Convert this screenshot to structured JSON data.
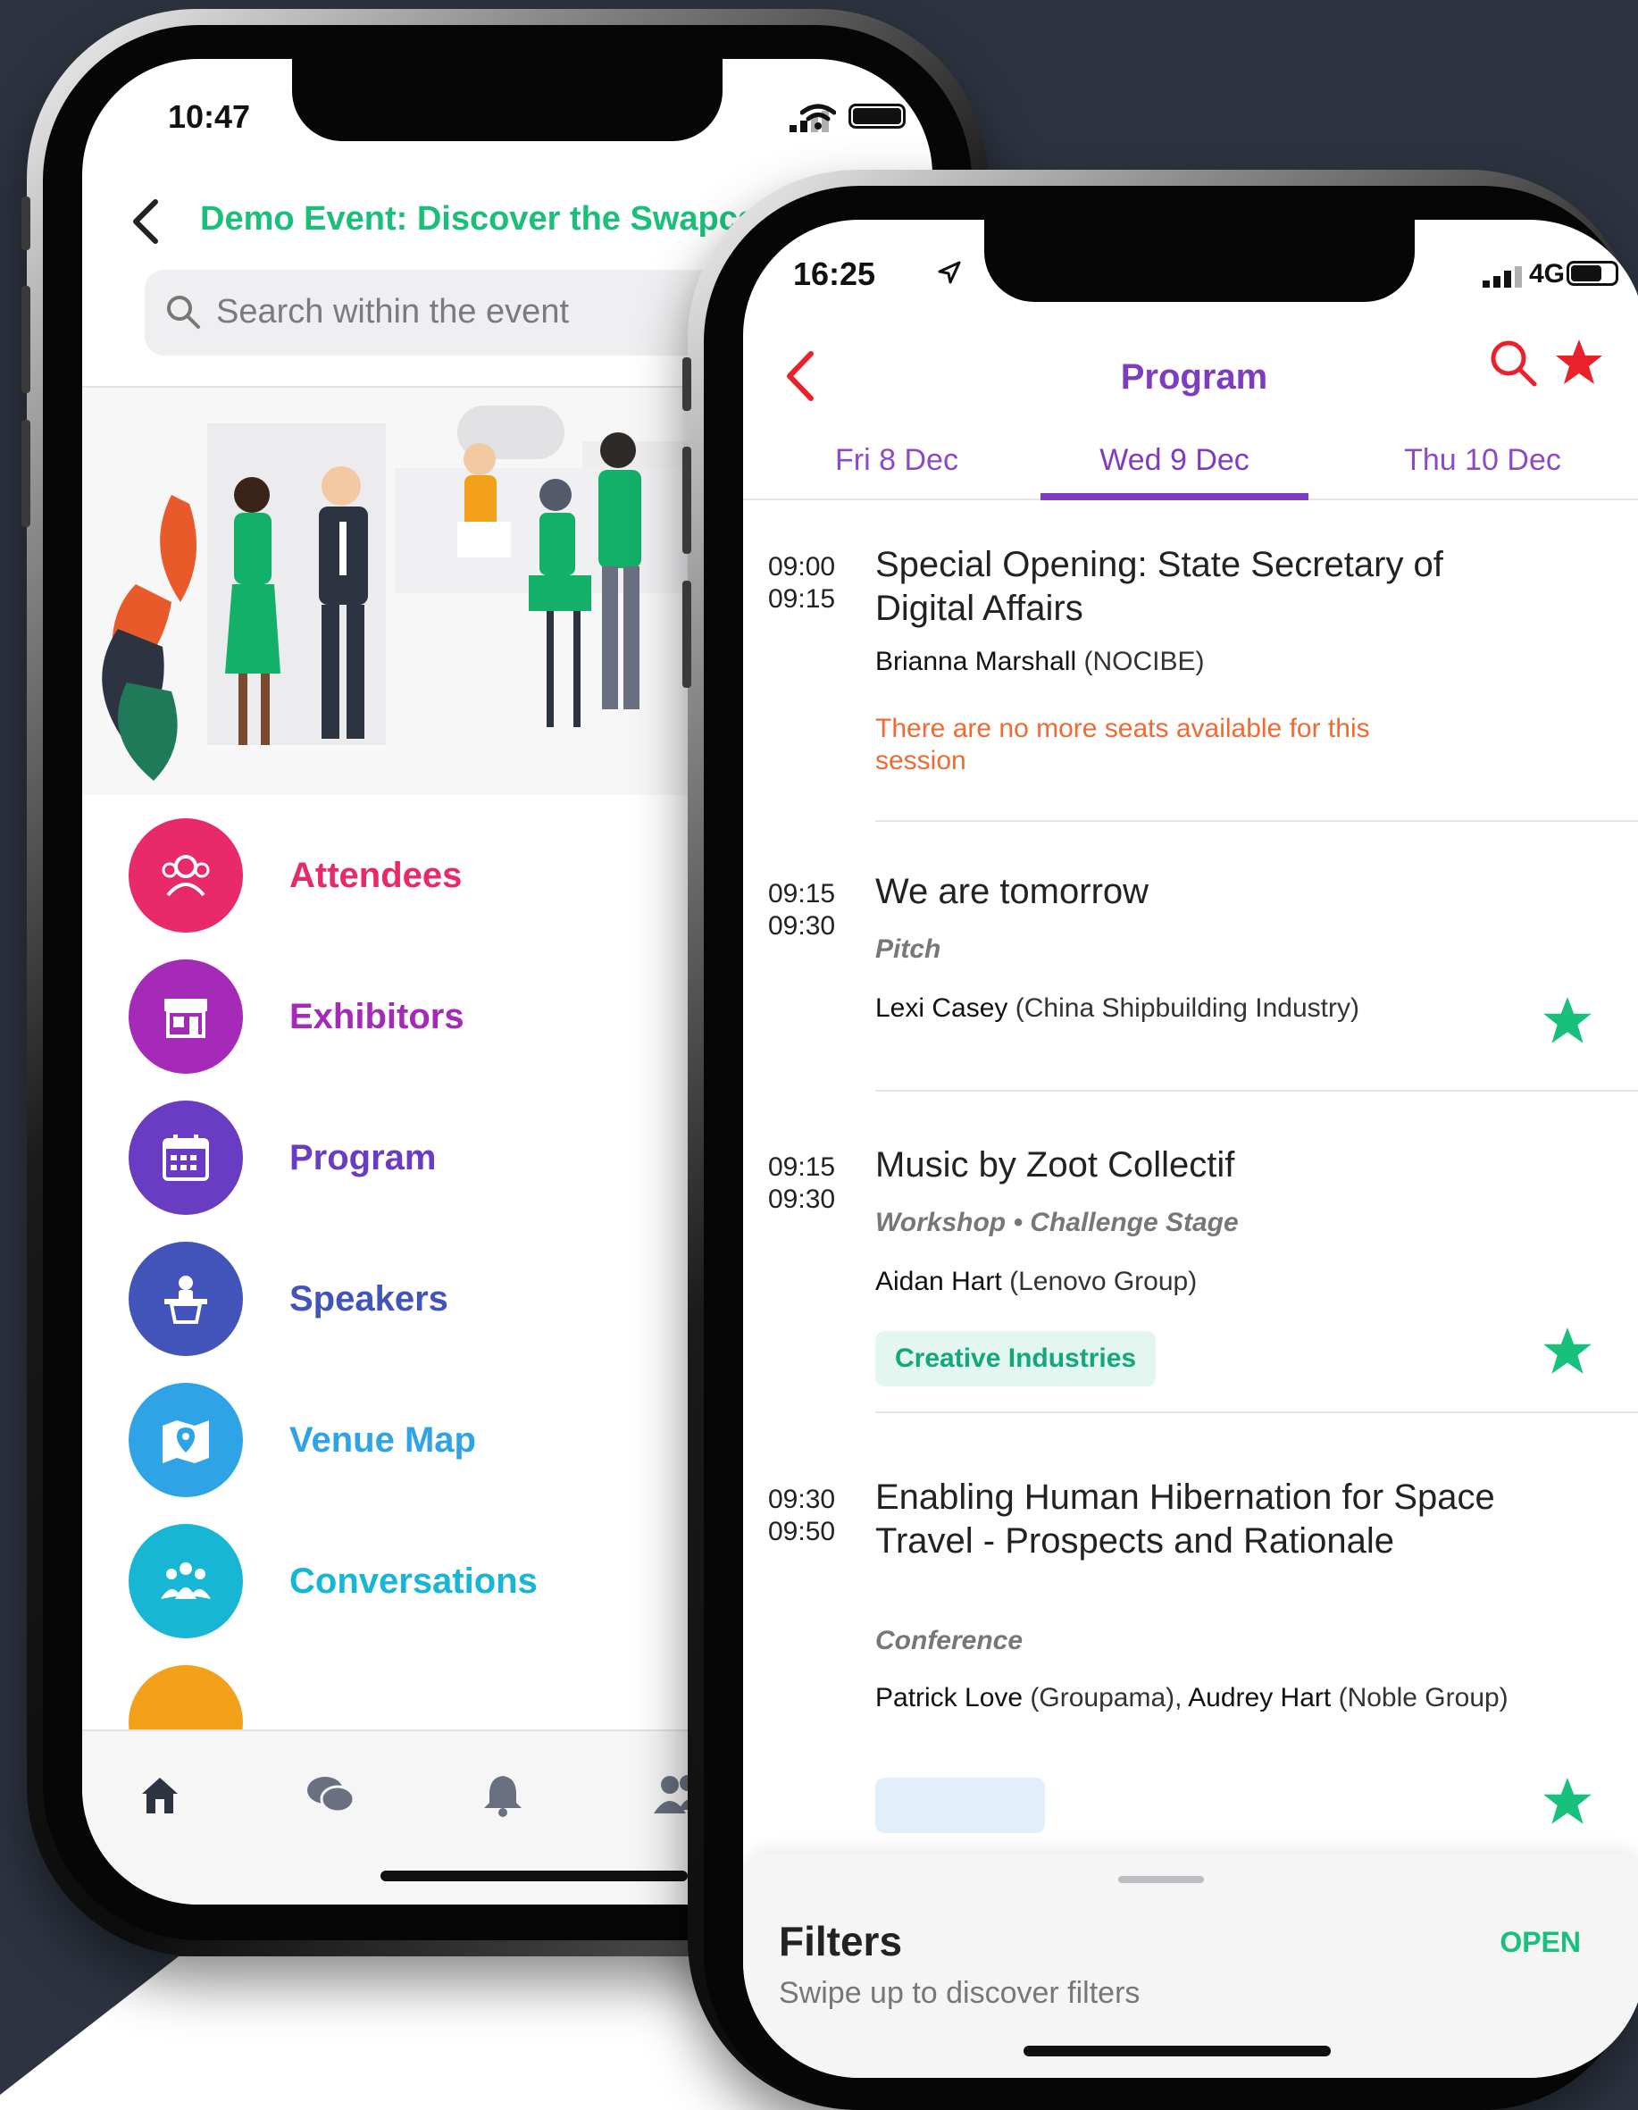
{
  "left_phone": {
    "status": {
      "time": "10:47"
    },
    "header": {
      "title": "Demo Event: Discover the Swapca"
    },
    "search": {
      "placeholder": "Search within the event"
    },
    "menu": [
      {
        "label": "Attendees",
        "icon": "attendees-icon",
        "color": "#e8296a"
      },
      {
        "label": "Exhibitors",
        "icon": "store-icon",
        "color": "#a52ab8"
      },
      {
        "label": "Program",
        "icon": "calendar-icon",
        "color": "#6a3bc3"
      },
      {
        "label": "Speakers",
        "icon": "podium-icon",
        "color": "#4254ba"
      },
      {
        "label": "Venue Map",
        "icon": "map-pin-icon",
        "color": "#2ea4e6"
      },
      {
        "label": "Conversations",
        "icon": "group-icon",
        "color": "#17b6d4"
      }
    ],
    "tabbar": [
      "home-icon",
      "chat-icon",
      "bell-icon",
      "people-icon"
    ]
  },
  "right_phone": {
    "status": {
      "time": "16:25",
      "network": "4G"
    },
    "header": {
      "title": "Program"
    },
    "tabs": [
      "Fri 8 Dec",
      "Wed 9 Dec",
      "Thu 10 Dec"
    ],
    "active_tab": "Wed 9 Dec",
    "sessions": [
      {
        "start": "09:00",
        "end": "09:15",
        "title": "Special Opening: State Secretary of Digital Affairs",
        "speakers": [
          {
            "name": "Brianna Marshall",
            "org": "(NOCIBE)"
          }
        ],
        "warning": "There are no more seats available for this session"
      },
      {
        "start": "09:15",
        "end": "09:30",
        "title": "We are tomorrow",
        "type": "Pitch",
        "speakers": [
          {
            "name": "Lexi Casey",
            "org": "(China Shipbuilding Industry)"
          }
        ],
        "starred": true
      },
      {
        "start": "09:15",
        "end": "09:30",
        "title": "Music by Zoot Collectif",
        "type": "Workshop • Challenge Stage",
        "speakers": [
          {
            "name": "Aidan Hart",
            "org": "(Lenovo Group)"
          }
        ],
        "tag": "Creative Industries",
        "starred": true
      },
      {
        "start": "09:30",
        "end": "09:50",
        "title": "Enabling Human Hibernation for Space Travel - Prospects and Rationale",
        "type": "Conference",
        "speakers_text": {
          "name1": "Patrick Love",
          "org1": "(Groupama),",
          "name2": "Audrey Hart",
          "org2": "(Noble Group)"
        }
      }
    ],
    "filters": {
      "title": "Filters",
      "subtitle": "Swipe up to discover filters",
      "open_label": "OPEN"
    }
  },
  "colors": {
    "accent_green": "#1abf7a",
    "accent_purple": "#7e3cc0",
    "warning": "#f06a33",
    "star_green": "#17c07d",
    "star_red": "#e8212a"
  }
}
